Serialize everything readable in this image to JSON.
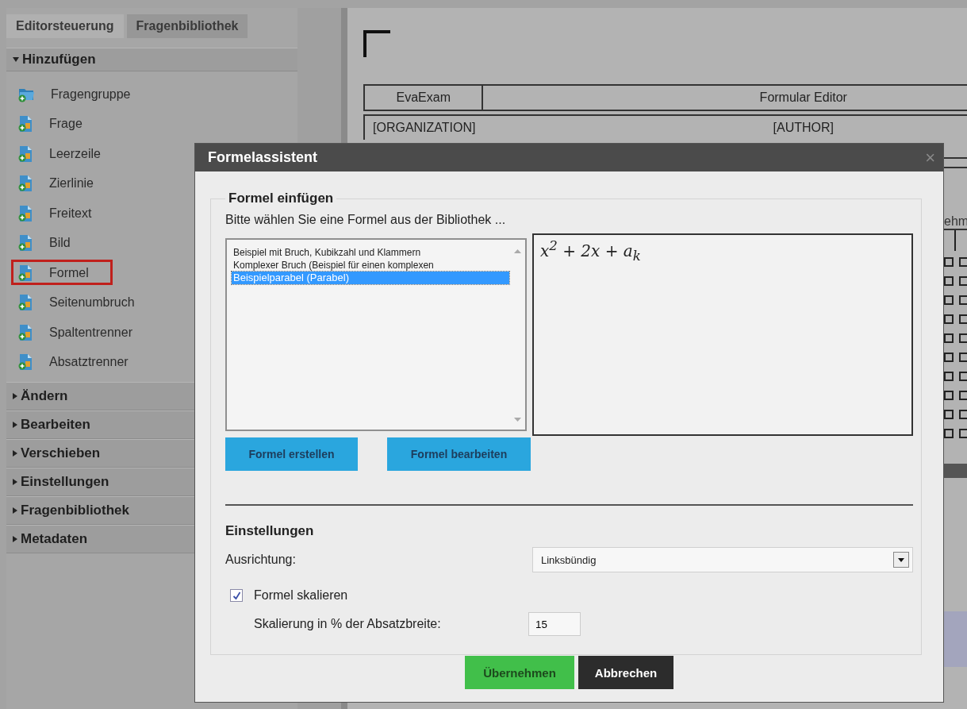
{
  "sidebar": {
    "tabs": [
      {
        "label": "Editorsteuerung",
        "selected": true
      },
      {
        "label": "Fragenbibliothek",
        "selected": false
      }
    ],
    "sections": [
      {
        "label": "Hinzufügen",
        "expanded": true,
        "items": [
          {
            "label": "Fragengruppe",
            "highlighted": false
          },
          {
            "label": "Frage",
            "highlighted": false
          },
          {
            "label": "Leerzeile",
            "highlighted": false
          },
          {
            "label": "Zierlinie",
            "highlighted": false
          },
          {
            "label": "Freitext",
            "highlighted": false
          },
          {
            "label": "Bild",
            "highlighted": false
          },
          {
            "label": "Formel",
            "highlighted": true
          },
          {
            "label": "Seitenumbruch",
            "highlighted": false
          },
          {
            "label": "Spaltentrenner",
            "highlighted": false
          },
          {
            "label": "Absatztrenner",
            "highlighted": false
          }
        ]
      },
      {
        "label": "Ändern",
        "expanded": false
      },
      {
        "label": "Bearbeiten",
        "expanded": false
      },
      {
        "label": "Verschieben",
        "expanded": false
      },
      {
        "label": "Einstellungen",
        "expanded": false
      },
      {
        "label": "Fragenbibliothek",
        "expanded": false
      },
      {
        "label": "Metadaten",
        "expanded": false
      }
    ]
  },
  "document": {
    "header_table": [
      [
        "EvaExam",
        "Formular Editor"
      ],
      [
        "[ORGANIZATION]",
        "[AUTHOR]"
      ]
    ],
    "column_heading": "ehm",
    "checkbox_columns": [
      [
        {
          "checked": false
        },
        {
          "checked": false
        },
        {
          "checked": false
        },
        {
          "checked": false
        },
        {
          "checked": false
        },
        {
          "checked": false
        },
        {
          "checked": false
        },
        {
          "checked": false
        },
        {
          "checked": false
        },
        {
          "checked": false
        }
      ],
      [
        {
          "checked": false
        },
        {
          "checked": false
        },
        {
          "checked": false
        },
        {
          "checked": false
        },
        {
          "checked": false
        },
        {
          "checked": false
        },
        {
          "checked": false
        },
        {
          "checked": false
        },
        {
          "checked": false
        },
        {
          "checked": false
        }
      ]
    ]
  },
  "dialog": {
    "title": "Formelassistent",
    "close": "×",
    "legend": "Formel einfügen",
    "instruction": "Bitte wählen Sie eine Formel aus der Bibliothek ...",
    "formulas": [
      {
        "label": "Beispiel mit Bruch, Kubikzahl und Klammern",
        "selected": false
      },
      {
        "label": "Komplexer Bruch (Beispiel für einen komplexen",
        "selected": false
      },
      {
        "label": "Beispielparabel (Parabel)",
        "selected": true
      }
    ],
    "preview": "x$^{2}$ + 2x + a$_{k}$",
    "formula_buttons": [
      "Formel erstellen",
      "Formel bearbeiten"
    ],
    "settings_heading": "Einstellungen",
    "alignment_label": "Ausrichtung:",
    "alignment_value": "Linksbündig",
    "scale_checkbox": {
      "label": "Formel skalieren",
      "checked": true
    },
    "scale_label": "Skalierung in % der Absatzbreite:",
    "scale_value": "15",
    "footer_buttons": [
      {
        "label": "Übernehmen",
        "kind": "primary"
      },
      {
        "label": "Abbrechen",
        "kind": "secondary"
      }
    ]
  }
}
